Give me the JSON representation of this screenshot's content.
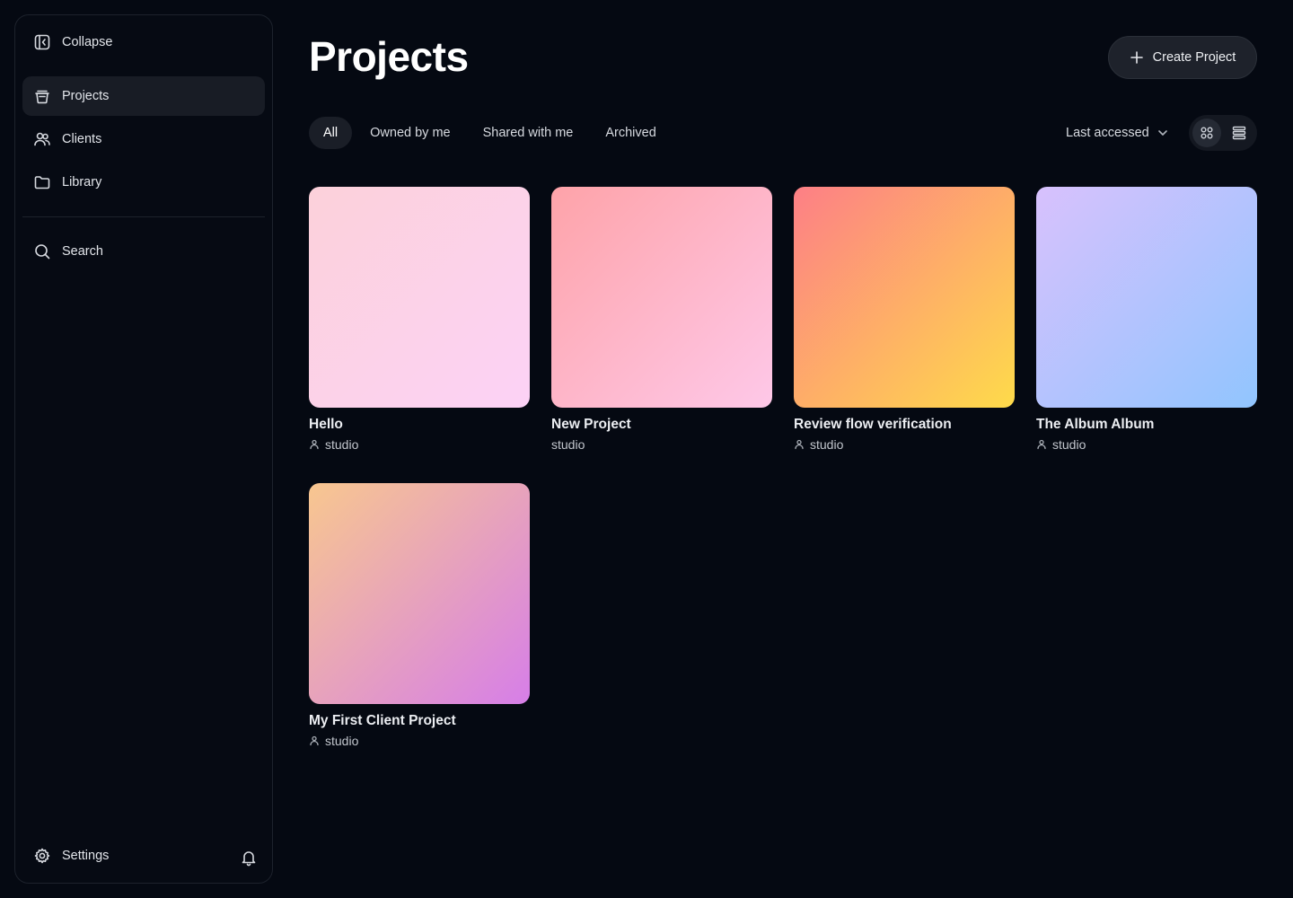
{
  "sidebar": {
    "collapse_label": "Collapse",
    "items": [
      {
        "label": "Projects",
        "icon": "projects-icon",
        "active": true
      },
      {
        "label": "Clients",
        "icon": "users-icon",
        "active": false
      },
      {
        "label": "Library",
        "icon": "folder-icon",
        "active": false
      }
    ],
    "search_label": "Search",
    "settings_label": "Settings",
    "notification_icon": "bell-icon"
  },
  "header": {
    "title": "Projects",
    "create_label": "Create Project"
  },
  "filters": {
    "tabs": [
      "All",
      "Owned by me",
      "Shared with me",
      "Archived"
    ],
    "active_tab": "All",
    "sort_label": "Last accessed",
    "view_modes": [
      "grid-view-icon",
      "list-view-icon"
    ],
    "active_view": "grid"
  },
  "projects": [
    {
      "name": "Hello",
      "owner": "studio",
      "shared_icon": true,
      "gradient": [
        "#fcd1da",
        "#fcd2f6"
      ]
    },
    {
      "name": "New Project",
      "owner": "studio",
      "shared_icon": false,
      "gradient": [
        "#fea3a9",
        "#fec8e8"
      ]
    },
    {
      "name": "Review flow verification",
      "owner": "studio",
      "shared_icon": true,
      "gradient": [
        "#fd7f86",
        "#fedb4a"
      ]
    },
    {
      "name": "The Album Album",
      "owner": "studio",
      "shared_icon": true,
      "gradient": [
        "#d8c1fd",
        "#91c5fe"
      ]
    },
    {
      "name": "My First Client Project",
      "owner": "studio",
      "shared_icon": true,
      "gradient": [
        "#f8c78f",
        "#d67ee8"
      ]
    }
  ],
  "colors": {
    "background": "#050912",
    "sidebar_active": "#181c25",
    "text": "#e7e9ee"
  }
}
